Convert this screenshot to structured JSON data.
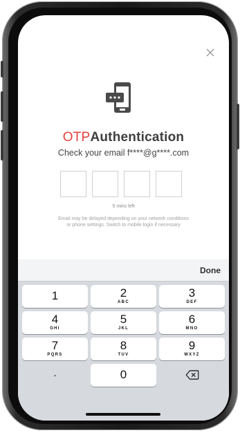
{
  "screen": {
    "title_part1": "OTP",
    "title_part2": "Authentication",
    "subtitle": "Check your email f****@g****.com",
    "otp_boxes": [
      "",
      "",
      "",
      ""
    ],
    "timer": "5 mins left",
    "notice_line1": "Email may be delayed depending on your network conditions",
    "notice_line2": "or phone settings. Switch to mobile login if necessary",
    "icons": {
      "close": "close-icon",
      "phone": "phone-message-icon",
      "backspace": "backspace-icon"
    },
    "colors": {
      "accent": "#e0413c",
      "title_dark": "#3e3e3e"
    }
  },
  "keyboard": {
    "done_label": "Done",
    "keys": [
      {
        "num": "1",
        "letters": ""
      },
      {
        "num": "2",
        "letters": "ABC"
      },
      {
        "num": "3",
        "letters": "DEF"
      },
      {
        "num": "4",
        "letters": "GHI"
      },
      {
        "num": "5",
        "letters": "JKL"
      },
      {
        "num": "6",
        "letters": "MNO"
      },
      {
        "num": "7",
        "letters": "PQRS"
      },
      {
        "num": "8",
        "letters": "TUV"
      },
      {
        "num": "9",
        "letters": "WXYZ"
      },
      {
        "num": ".",
        "letters": ""
      },
      {
        "num": "0",
        "letters": ""
      }
    ]
  }
}
